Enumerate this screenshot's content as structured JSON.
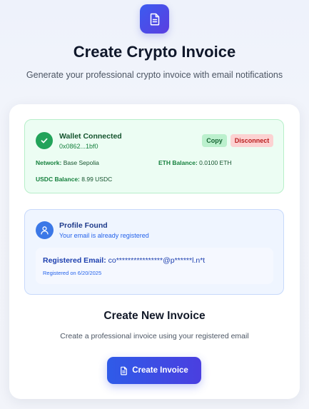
{
  "header": {
    "logo_icon": "document-icon",
    "title": "Create Crypto Invoice",
    "subtitle": "Generate your professional crypto invoice with email notifications"
  },
  "wallet": {
    "status_icon": "check-circle-icon",
    "title": "Wallet Connected",
    "address": "0x0862...1bf0",
    "copy_label": "Copy",
    "disconnect_label": "Disconnect",
    "network_label": "Network:",
    "network_value": "Base Sepolia",
    "eth_label": "ETH Balance:",
    "eth_value": "0.0100 ETH",
    "usdc_label": "USDC Balance:",
    "usdc_value": "8.99 USDC"
  },
  "profile": {
    "icon": "user-icon",
    "title": "Profile Found",
    "subtitle": "Your email is already registered",
    "email_label": "Registered Email:",
    "email_value": "co****************@p******l.n*t",
    "registered_on": "Registered on 6/20/2025"
  },
  "invoice": {
    "title": "Create New Invoice",
    "subtitle": "Create a professional invoice using your registered email",
    "button_label": "Create Invoice",
    "button_icon": "document-icon"
  },
  "colors": {
    "primary": "#3b5bf0",
    "success": "#22a35a",
    "danger": "#b91c1c",
    "info": "#3b78e7"
  }
}
